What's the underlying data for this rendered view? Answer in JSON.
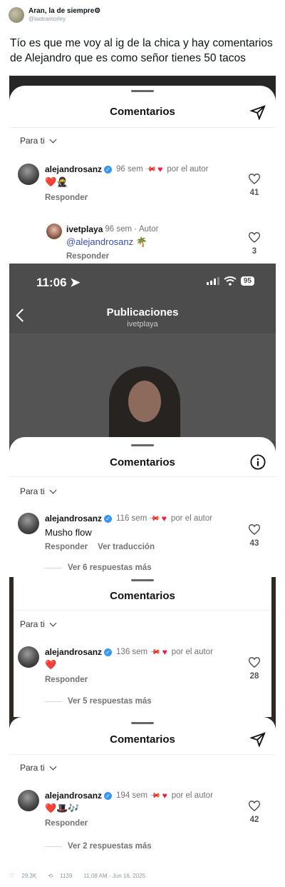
{
  "tweet": {
    "name": "Aran, la de siempre",
    "handle": "@laotramorley",
    "text": "Tío es que me voy al ig de la chica y hay comentarios de Alejandro que es como señor tienes 50 tacos",
    "likes": "29.3K",
    "retweets": "1139",
    "timestamp": "11:08 AM · Jun 16, 2025"
  },
  "sheet": {
    "title": "Comentarios",
    "filter": "Para ti"
  },
  "shot1": {
    "comment1": {
      "user": "alejandrosanz",
      "time": "96 sem",
      "author_tag": "por el autor",
      "text": "❤️🥷",
      "reply": "Responder",
      "likes": "41"
    },
    "reply1": {
      "user": "ivetplaya",
      "time": "96 sem",
      "tag": "Autor",
      "text": "@alejandrosanz 🌴",
      "reply": "Responder",
      "likes": "3"
    }
  },
  "shot2": {
    "status_time": "11:06",
    "battery": "95",
    "page_title": "Publicaciones",
    "page_subtitle": "ivetplaya",
    "comment": {
      "user": "alejandrosanz",
      "time": "116 sem",
      "author_tag": "por el autor",
      "text": "Musho flow",
      "reply": "Responder",
      "translate": "Ver traducción",
      "likes": "43",
      "more": "Ver 6 respuestas más"
    }
  },
  "shot3": {
    "comment": {
      "user": "alejandrosanz",
      "time": "136 sem",
      "author_tag": "por el autor",
      "text": "❤️",
      "reply": "Responder",
      "likes": "28",
      "more": "Ver 5 respuestas más"
    }
  },
  "shot4": {
    "comment": {
      "user": "alejandrosanz",
      "time": "194 sem",
      "author_tag": "por el autor",
      "text": "❤️🎩🎶",
      "reply": "Responder",
      "likes": "42",
      "more": "Ver 2 respuestas más"
    }
  }
}
